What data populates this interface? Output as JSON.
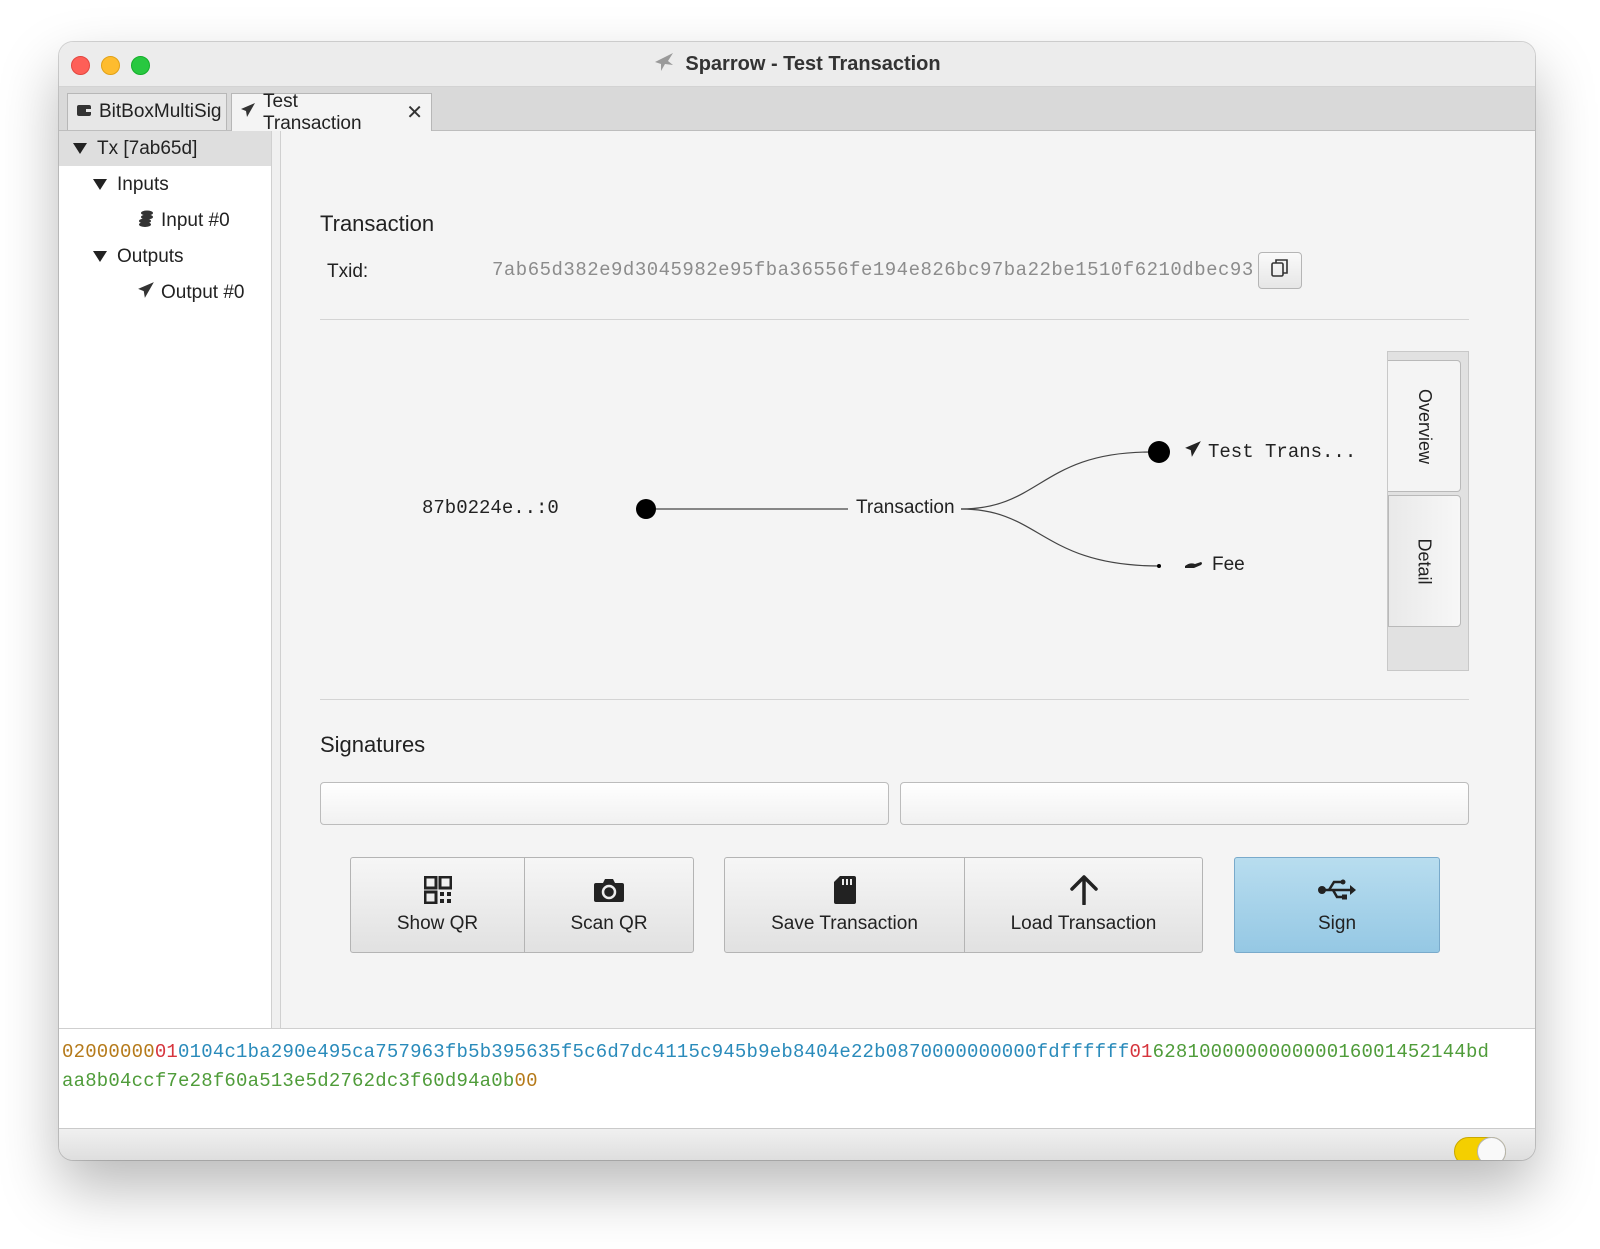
{
  "window": {
    "title": "Sparrow - Test Transaction"
  },
  "tabs": [
    {
      "label": "BitBoxMultiSig",
      "icon": "wallet-icon"
    },
    {
      "label": "Test Transaction",
      "icon": "send-icon",
      "close": "✕"
    }
  ],
  "tree": {
    "root": "Tx [7ab65d]",
    "inputs_label": "Inputs",
    "input_item": "Input #0",
    "outputs_label": "Outputs",
    "output_item": "Output #0"
  },
  "transaction": {
    "section_title": "Transaction",
    "txid_label": "Txid:",
    "txid_value": "7ab65d382e9d3045982e95fba36556fe194e826bc97ba22be1510f6210dbec93"
  },
  "diagram": {
    "input_label": "87b0224e..:0",
    "center_label": "Transaction",
    "output_label": "Test Trans...",
    "fee_label": "Fee"
  },
  "side_tabs": {
    "overview": "Overview",
    "detail": "Detail"
  },
  "signatures": {
    "section_title": "Signatures"
  },
  "buttons": {
    "show_qr": "Show QR",
    "scan_qr": "Scan QR",
    "save_transaction": "Save Transaction",
    "load_transaction": "Load Transaction",
    "sign": "Sign"
  },
  "hex": {
    "line1": [
      {
        "text": "02000000",
        "color": "#b57a1a"
      },
      {
        "text": "01",
        "color": "#d6343c"
      },
      {
        "text": "0104c1ba290e495ca757963fb5b395635f5c6d7dc4115c945b9eb8404e22b087",
        "color": "#2a8bbb"
      },
      {
        "text": "00000000",
        "color": "#2a8bbb"
      },
      {
        "text": "00",
        "color": "#2a8bbb"
      },
      {
        "text": "fdffffff",
        "color": "#2a8bbb"
      },
      {
        "text": "01",
        "color": "#d6343c"
      },
      {
        "text": "6281000000000000",
        "color": "#4f9c3a"
      },
      {
        "text": "1600145214",
        "color": "#4f9c3a"
      },
      {
        "text": "4bd",
        "color": "#4f9c3a"
      }
    ],
    "line2": [
      {
        "text": "aa8b04ccf7e28f60a513e5d2762dc3f60d94a0b",
        "color": "#4f9c3a"
      },
      {
        "text": "00",
        "color": "#b57a1a"
      }
    ]
  },
  "colors": {
    "accent_sign": "#a6d3ea",
    "toggle": "#f4cf00"
  }
}
